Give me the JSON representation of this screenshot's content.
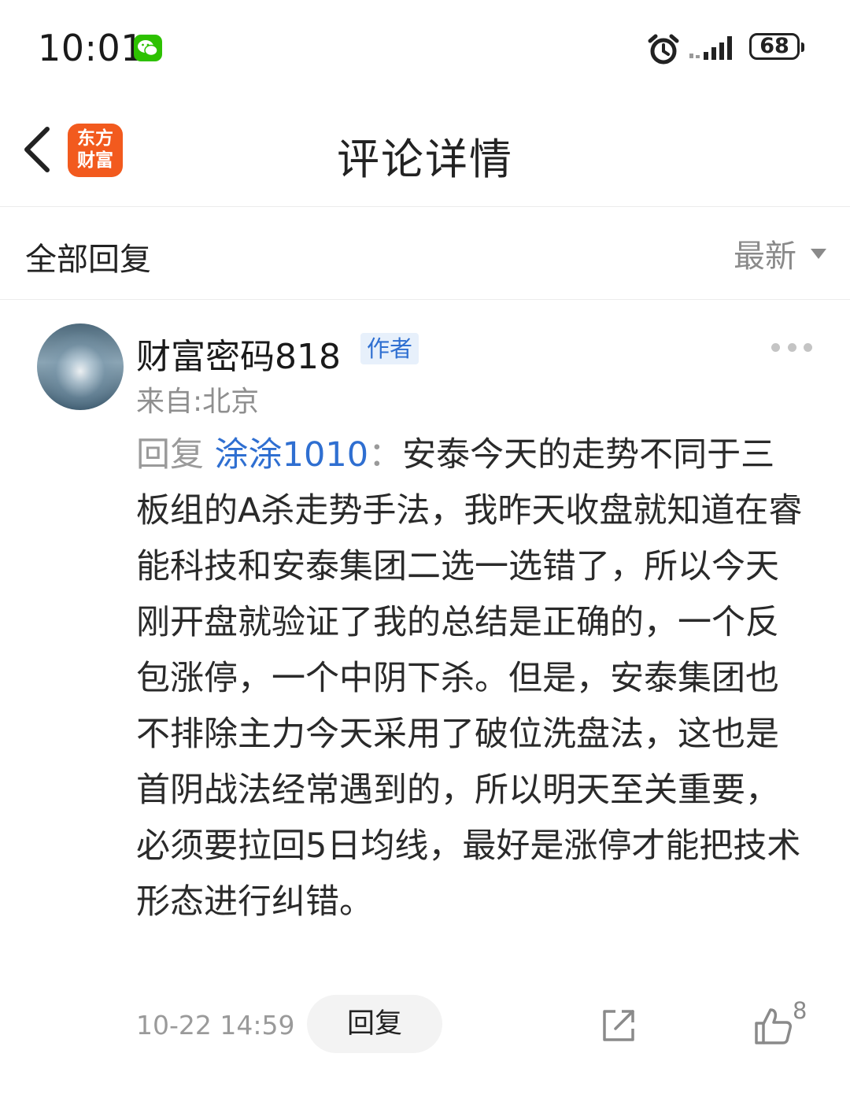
{
  "status_bar": {
    "time": "10:01",
    "battery": "68",
    "icons": [
      "wechat-icon",
      "alarm-icon",
      "signal-icon",
      "battery-icon"
    ]
  },
  "nav": {
    "back_icon": "chevron-left-icon",
    "logo_line1": "东方",
    "logo_line2": "财富",
    "title": "评论详情"
  },
  "filter": {
    "title": "全部回复",
    "sort_label": "最新"
  },
  "comment": {
    "username": "财富密码818",
    "author_badge": "作者",
    "location": "来自:北京",
    "reply_prefix": "回复",
    "reply_target": "涂涂1010",
    "reply_colon": "：",
    "text": "安泰今天的走势不同于三板组的A杀走势手法，我昨天收盘就知道在睿能科技和安泰集团二选一选错了，所以今天刚开盘就验证了我的总结是正确的，一个反包涨停，一个中阴下杀。但是，安泰集团也不排除主力今天采用了破位洗盘法，这也是首阴战法经常遇到的，所以明天至关重要，必须要拉回5日均线，最好是涨停才能把技术形态进行纠错。",
    "time": "10-22 14:59",
    "reply_button": "回复",
    "like_count": "8"
  },
  "colors": {
    "accent_blue": "#2f6fd1",
    "logo_orange": "#f25a1e",
    "wechat_green": "#2dc100"
  }
}
